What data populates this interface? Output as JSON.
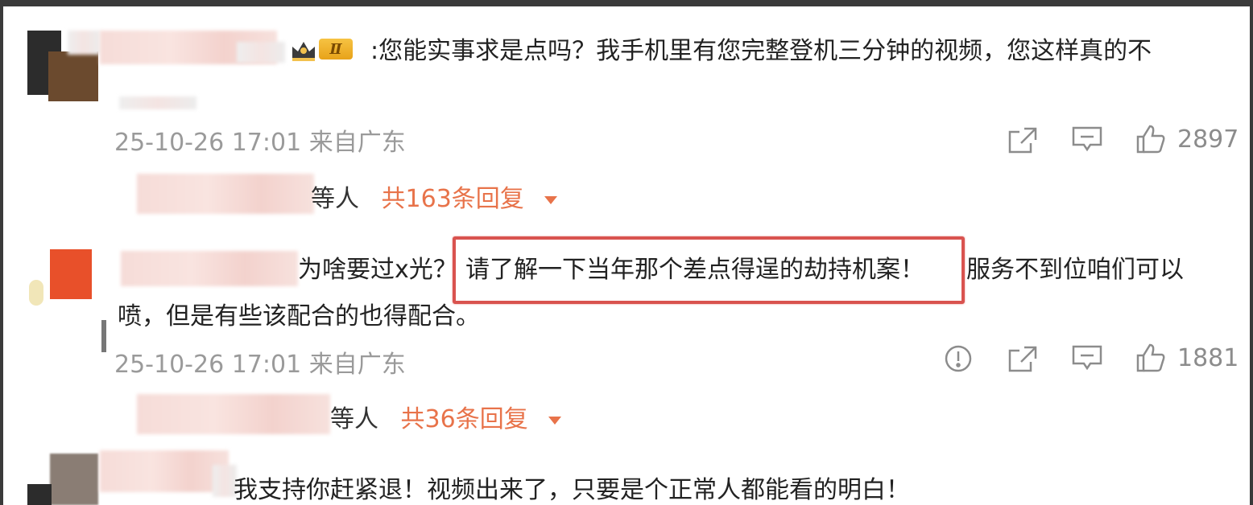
{
  "comments": [
    {
      "text_line1": ":您能实事求是点吗？我手机里有您完整登机三分钟的视频，您这样真的不",
      "level_badge": "Ⅱ",
      "timestamp": "25-10-26 17:01 来自广东",
      "likes": "2897",
      "reply_suffix": "等人",
      "reply_count": "共163条回复"
    },
    {
      "text_prefix": "为啥要过x光？",
      "text_highlight": "请了解一下当年那个差点得逞的劫持机案！",
      "text_suffix": "服务不到位咱们可以",
      "text_line2": "喷，但是有些该配合的也得配合。",
      "timestamp": "25-10-26 17:01 来自广东",
      "likes": "1881",
      "reply_suffix": "等人",
      "reply_count": "共36条回复"
    },
    {
      "text_line1": "我支持你赶紧退！视频出来了，只要是个正常人都能看的明白！"
    }
  ],
  "icons": {
    "share": "share-icon",
    "comment": "comment-icon",
    "like": "like-icon",
    "report": "report-icon"
  },
  "colors": {
    "reply_accent": "#e8734a",
    "highlight_border": "#d9534f",
    "meta_text": "#9a9a9a"
  }
}
